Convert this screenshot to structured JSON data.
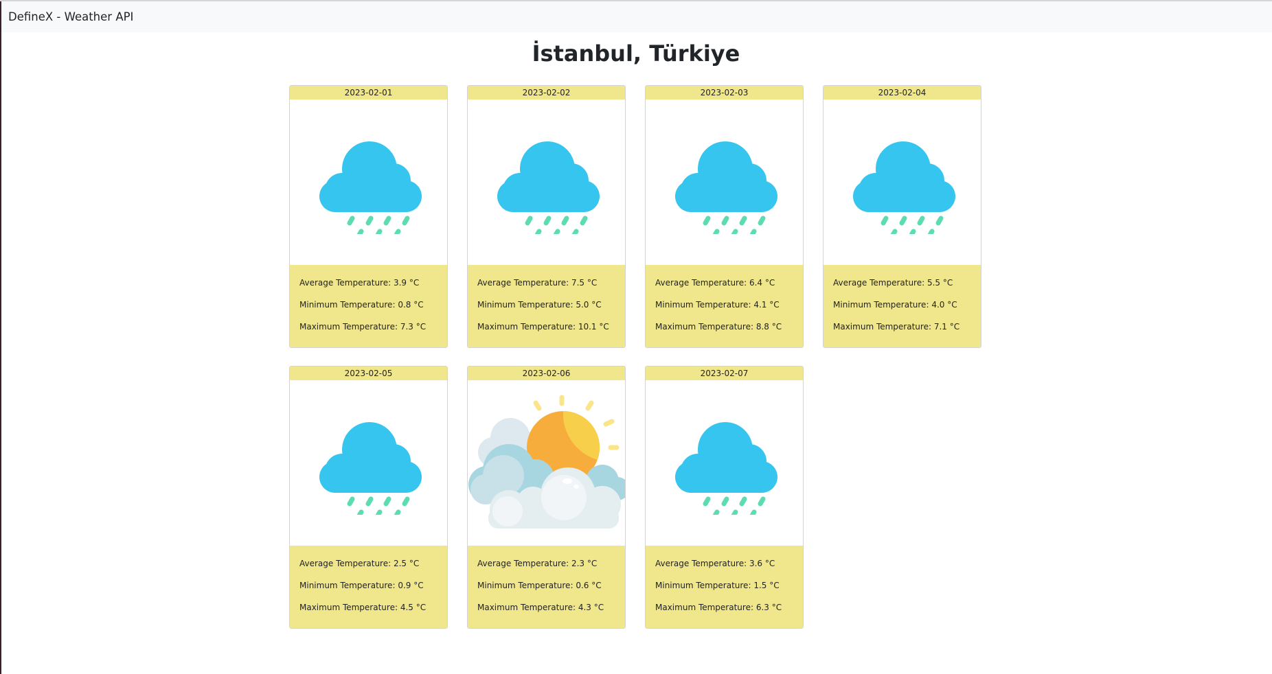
{
  "app": {
    "brand": "DefineX - Weather API"
  },
  "page": {
    "title": "İstanbul, Türkiye"
  },
  "labels": {
    "avg": "Average Temperature:",
    "min": "Minimum Temperature:",
    "max": "Maximum Temperature:"
  },
  "days": [
    {
      "date": "2023-02-01",
      "icon": "rain-cloud-icon",
      "avg": "3.9 °C",
      "min": "0.8 °C",
      "max": "7.3 °C"
    },
    {
      "date": "2023-02-02",
      "icon": "rain-cloud-icon",
      "avg": "7.5 °C",
      "min": "5.0 °C",
      "max": "10.1 °C"
    },
    {
      "date": "2023-02-03",
      "icon": "rain-cloud-icon",
      "avg": "6.4 °C",
      "min": "4.1 °C",
      "max": "8.8 °C"
    },
    {
      "date": "2023-02-04",
      "icon": "rain-cloud-icon",
      "avg": "5.5 °C",
      "min": "4.0 °C",
      "max": "7.1 °C"
    },
    {
      "date": "2023-02-05",
      "icon": "rain-cloud-icon",
      "avg": "2.5 °C",
      "min": "0.9 °C",
      "max": "4.5 °C"
    },
    {
      "date": "2023-02-06",
      "icon": "partly-cloudy-icon",
      "avg": "2.3 °C",
      "min": "0.6 °C",
      "max": "4.3 °C"
    },
    {
      "date": "2023-02-07",
      "icon": "rain-cloud-icon",
      "avg": "3.6 °C",
      "min": "1.5 °C",
      "max": "6.3 °C"
    }
  ],
  "colors": {
    "card_accent": "#f0e68c",
    "cloud_blue": "#35c5ee",
    "rain_green": "#5ddcb4",
    "sun_orange": "#f7ad3c"
  }
}
